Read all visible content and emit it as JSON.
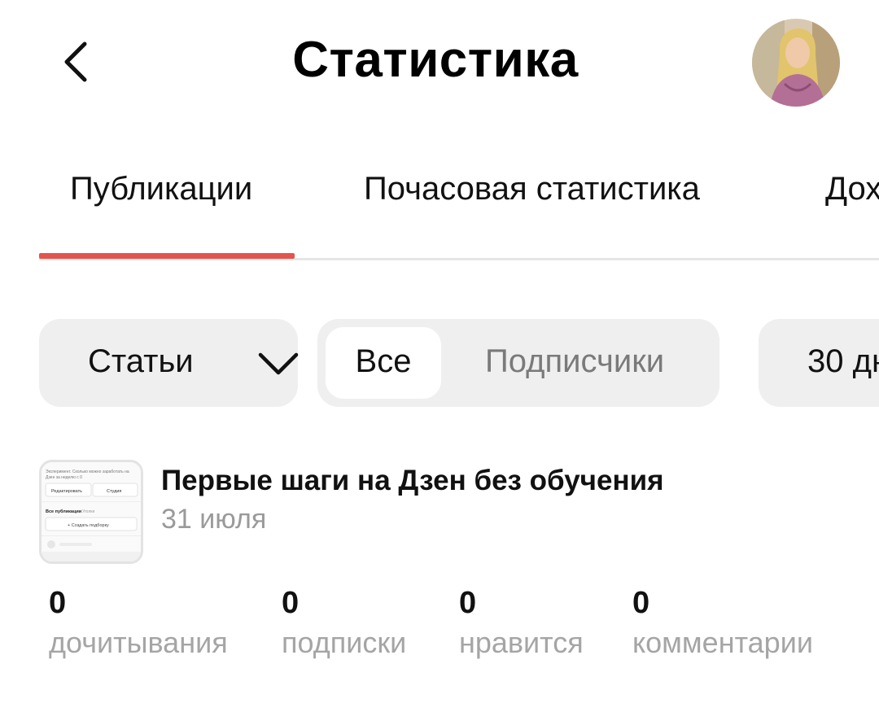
{
  "header": {
    "title": "Статистика",
    "back_icon": "chevron-left-icon",
    "avatar": "user-avatar"
  },
  "tabs": [
    {
      "label": "Публикации",
      "active": true
    },
    {
      "label": "Почасовая статистика",
      "active": false
    },
    {
      "label": "Дох",
      "active": false
    }
  ],
  "filters": {
    "type": {
      "value": "Статьи",
      "icon": "chevron-down-icon"
    },
    "audience": {
      "options": [
        "Все",
        "Подписчики"
      ],
      "selected": "Все"
    },
    "period": {
      "value": "30 дн"
    }
  },
  "publication": {
    "title": "Первые шаги на Дзен без обучения",
    "date": "31 июля",
    "thumbnail": {
      "line1": "Эксперимент. Сколько можно заработать на",
      "line2": "Дзен за неделю с 0",
      "btn_edit": "Редактировать",
      "btn_studio": "Студия",
      "all_pubs": "Все публикации",
      "cols": "Уголки",
      "create": "+ Создать подборку"
    }
  },
  "stats": [
    {
      "value": "0",
      "label": "дочитывания"
    },
    {
      "value": "0",
      "label": "подписки"
    },
    {
      "value": "0",
      "label": "нравится"
    },
    {
      "value": "0",
      "label": "комментарии"
    }
  ],
  "colors": {
    "accent": "#e4534d",
    "pill_bg": "#efefef",
    "muted": "#a5a5a5"
  }
}
